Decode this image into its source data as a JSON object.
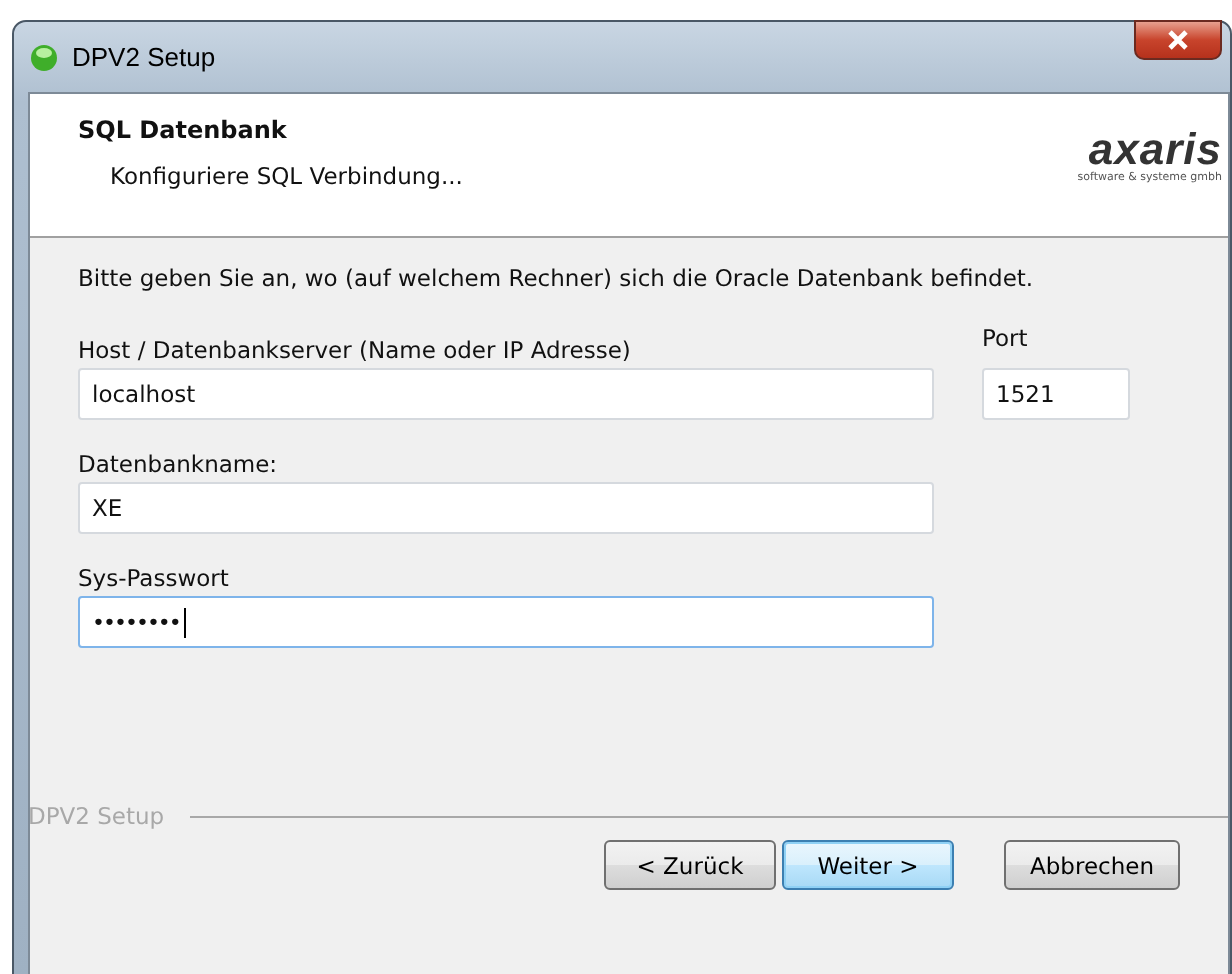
{
  "window": {
    "title": "DPV2 Setup"
  },
  "header": {
    "title": "SQL Datenbank",
    "subtitle": "Konfiguriere SQL Verbindung...",
    "logo": {
      "name": "axaris",
      "tagline": "software & systeme gmbh"
    }
  },
  "intro": "Bitte geben Sie an, wo (auf welchem Rechner) sich die Oracle Datenbank befindet.",
  "fields": [
    {
      "label": "Host / Datenbankserver (Name oder IP Adresse)",
      "value": "localhost",
      "focused": false
    },
    {
      "label": "Port",
      "value": "1521",
      "focused": false
    },
    {
      "label": "Datenbankname:",
      "value": "XE",
      "focused": false
    },
    {
      "label": "Sys-Passwort",
      "value": "••••••••",
      "focused": true
    }
  ],
  "footer": {
    "group_label": "DPV2 Setup"
  },
  "buttons": [
    {
      "label": "< Zurück",
      "default": false
    },
    {
      "label": "Weiter >",
      "default": true
    },
    {
      "label": "Abbrechen",
      "default": false
    }
  ]
}
